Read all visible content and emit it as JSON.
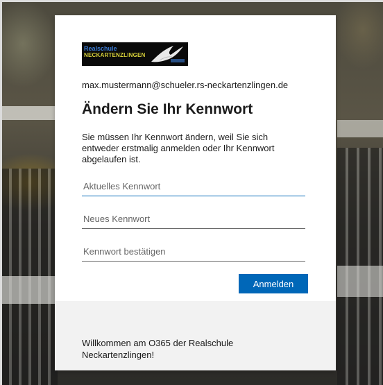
{
  "logo": {
    "line1": "Realschule",
    "line2": "NECKARTENZLINGEN"
  },
  "identity": {
    "email": "max.mustermann@schueler.rs-neckartenzlingen.de"
  },
  "heading": {
    "title": "Ändern Sie Ihr Kennwort",
    "description": "Sie müssen Ihr Kennwort ändern, weil Sie sich entweder erstmalig anmelden oder Ihr Kennwort abgelaufen ist."
  },
  "form": {
    "current_password": {
      "placeholder": "Aktuelles Kennwort",
      "value": ""
    },
    "new_password": {
      "placeholder": "Neues Kennwort",
      "value": ""
    },
    "confirm_password": {
      "placeholder": "Kennwort bestätigen",
      "value": ""
    },
    "submit_label": "Anmelden"
  },
  "footer": {
    "text": "Willkommen am O365 der Realschule Neckartenzlingen!"
  },
  "colors": {
    "accent": "#0067b8",
    "footer_bg": "#f2f2f2"
  }
}
